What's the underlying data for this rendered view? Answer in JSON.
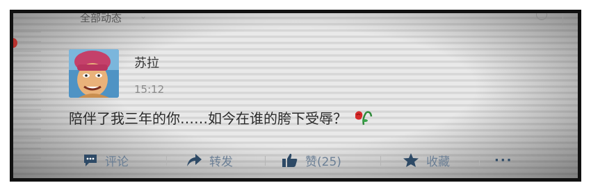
{
  "top": {
    "title": "全部动态"
  },
  "post": {
    "username": "苏拉",
    "time": "15:12",
    "text": "陪伴了我三年的你……如今在谁的胯下受辱？"
  },
  "actions": {
    "comment_label": "评论",
    "forward_label": "转发",
    "like_label": "赞(25)",
    "favorite_label": "收藏",
    "more_label": "···"
  },
  "colors": {
    "action_color": "#6b7f95",
    "icon_color": "#2e4a66"
  }
}
